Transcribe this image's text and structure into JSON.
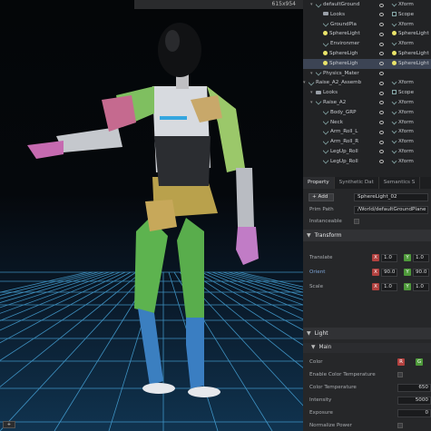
{
  "viewport": {
    "resolution": "615x954",
    "corner_label": "+"
  },
  "stage": {
    "rows": [
      {
        "name": "defaultGround",
        "type": "Xform",
        "icon": "xform-icon",
        "indent": 1,
        "selected": false
      },
      {
        "name": "Looks",
        "type": "Scope",
        "icon": "folder-icon",
        "indent": 2,
        "selected": false
      },
      {
        "name": "GroundPla",
        "type": "Xform",
        "icon": "xform-icon",
        "indent": 2,
        "selected": false
      },
      {
        "name": "SphereLight",
        "type": "SphereLight",
        "icon": "light-icon",
        "indent": 2,
        "selected": false
      },
      {
        "name": "Environmer",
        "type": "Xform",
        "icon": "xform-icon",
        "indent": 2,
        "selected": false
      },
      {
        "name": "SphereLigh",
        "type": "SphereLight",
        "icon": "light-icon",
        "indent": 2,
        "selected": false
      },
      {
        "name": "SphereLigh",
        "type": "SphereLight",
        "icon": "light-icon",
        "indent": 2,
        "selected": true
      },
      {
        "name": "Physics_Mater",
        "type": "",
        "icon": "xform-icon",
        "indent": 1,
        "selected": false
      },
      {
        "name": "Raise_A2_Assemb",
        "type": "Xform",
        "icon": "xform-icon",
        "indent": 0,
        "selected": false
      },
      {
        "name": "Looks",
        "type": "Scope",
        "icon": "folder-icon",
        "indent": 1,
        "selected": false
      },
      {
        "name": "Raise_A2",
        "type": "Xform",
        "icon": "xform-icon",
        "indent": 1,
        "selected": false
      },
      {
        "name": "Body_GRP",
        "type": "Xform",
        "icon": "xform-icon",
        "indent": 2,
        "selected": false
      },
      {
        "name": "Neck",
        "type": "Xform",
        "icon": "xform-icon",
        "indent": 2,
        "selected": false
      },
      {
        "name": "Arm_Roll_L",
        "type": "Xform",
        "icon": "xform-icon",
        "indent": 2,
        "selected": false
      },
      {
        "name": "Arm_Roll_R",
        "type": "Xform",
        "icon": "xform-icon",
        "indent": 2,
        "selected": false
      },
      {
        "name": "LegUp_Roll",
        "type": "Xform",
        "icon": "xform-icon",
        "indent": 2,
        "selected": false
      },
      {
        "name": "LegUp_Roll",
        "type": "Xform",
        "icon": "xform-icon",
        "indent": 2,
        "selected": false
      }
    ]
  },
  "props": {
    "tabs": [
      "Property",
      "Synthetic Dat",
      "Semantics S"
    ],
    "add_label": "+ Add",
    "prim_name": "SphereLight_02",
    "prim_path_label": "Prim Path",
    "prim_path": "/World/defaultGroundPlane",
    "instanceable_label": "Instanceable",
    "transform_section": "Transform",
    "translate_label": "Translate",
    "orient_label": "Orient",
    "scale_label": "Scale",
    "translate": {
      "x": "1.0",
      "y": "1.0"
    },
    "orient": {
      "x": "90.0",
      "y": "90.0"
    },
    "scale": {
      "x": "1.0",
      "y": "1.0"
    },
    "light_section": "Light",
    "main_sub": "Main",
    "color_label": "Color",
    "enable_color_temp_label": "Enable Color Temperature",
    "color_temp_label": "Color Temperature",
    "color_temp_value": "650",
    "intensity_label": "Intensity",
    "intensity_value": "5000",
    "exposure_label": "Exposure",
    "exposure_value": "0",
    "normalize_label": "Normalize Power",
    "colors": {
      "accent_selection": "#3c4454",
      "axis_x": "#b2413f",
      "axis_y": "#4e9a3a",
      "axis_z": "#3a63b0"
    }
  }
}
